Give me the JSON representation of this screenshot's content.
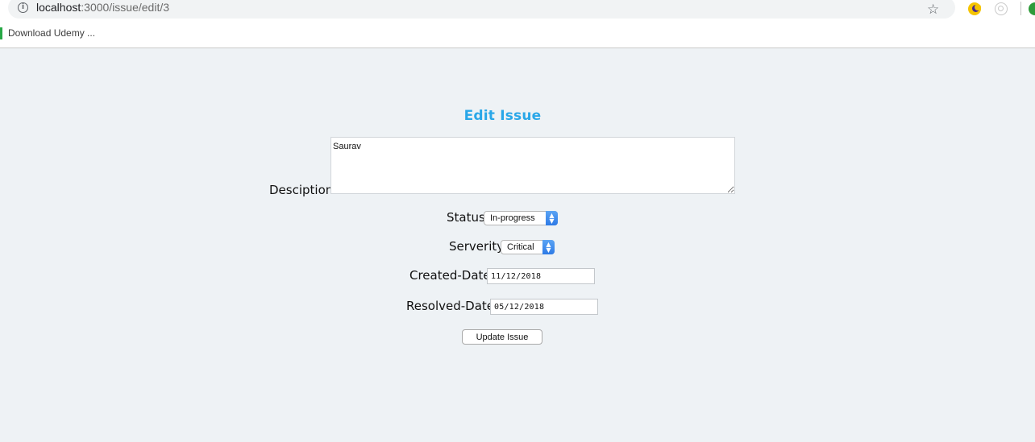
{
  "browser": {
    "url_host": "localhost",
    "url_rest": ":3000/issue/edit/3",
    "bookmark_label": "Download Udemy ..."
  },
  "form": {
    "title": "Edit Issue",
    "description_label": "Desciption:",
    "description_value": "Saurav",
    "status_label": "Status:",
    "status_value": "In-progress",
    "severity_label": "Serverity:",
    "severity_value": "Critical",
    "created_label": "Created-Date:",
    "created_value": "11/12/2018",
    "resolved_label": "Resolved-Date:",
    "resolved_value": "05/12/2018",
    "submit_label": "Update Issue"
  },
  "colors": {
    "title": "#2aa7e8",
    "page_bg": "#eef2f5",
    "select_accent": "#2d7ae6"
  }
}
